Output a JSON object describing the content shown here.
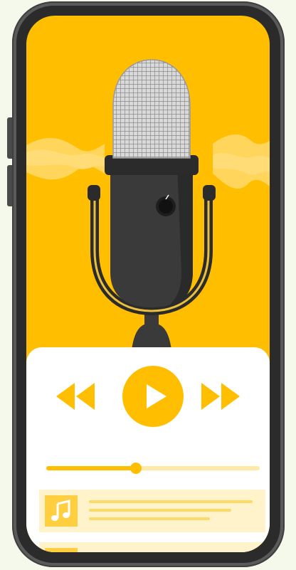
{
  "colors": {
    "background": "#f4f9ec",
    "phone_frame": "#5a5a5a",
    "accent": "#ffbe00",
    "accent_light": "#fff3cc",
    "card": "#ffffff",
    "mic_body": "#3a3a3a"
  },
  "icons": {
    "microphone": "microphone-icon",
    "rewind": "rewind-icon",
    "play": "play-icon",
    "forward": "fast-forward-icon",
    "music_note": "music-note-icon"
  },
  "player": {
    "progress_fraction": 0.42
  },
  "playlist": {
    "tracks": [
      {
        "icon": "music-note-icon"
      },
      {
        "icon": "music-note-icon"
      }
    ]
  }
}
